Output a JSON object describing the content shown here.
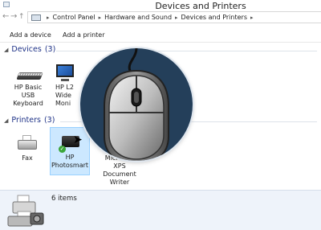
{
  "window": {
    "title": "Devices and Printers"
  },
  "address": {
    "crumbs": [
      "Control Panel",
      "Hardware and Sound",
      "Devices and Printers"
    ]
  },
  "commands": {
    "add_device": "Add a device",
    "add_printer": "Add a printer"
  },
  "devices_group": {
    "title": "Devices",
    "count": "(3)",
    "items": [
      {
        "lines": [
          "HP Basic",
          "USB",
          "Keyboard"
        ],
        "icon": "keyboard-icon"
      },
      {
        "lines": [
          "HP L2",
          "Wide",
          "Moni"
        ],
        "icon": "monitor-icon"
      }
    ]
  },
  "printers_group": {
    "title": "Printers",
    "count": "(3)",
    "items": [
      {
        "lines": [
          "Fax"
        ],
        "icon": "fax-icon"
      },
      {
        "lines": [
          "HP",
          "Photosmart"
        ],
        "icon": "printer-icon",
        "selected": true,
        "default": true
      },
      {
        "lines": [
          "Microsoft",
          "XPS",
          "Document",
          "Writer"
        ],
        "icon": "xps-printer-icon"
      }
    ]
  },
  "status": {
    "items_count": "6 items"
  },
  "colors": {
    "group_header": "#1e3287",
    "selection": "#cce8ff",
    "zoom_background": "#243f5a",
    "status_bar": "#eef3fa"
  }
}
